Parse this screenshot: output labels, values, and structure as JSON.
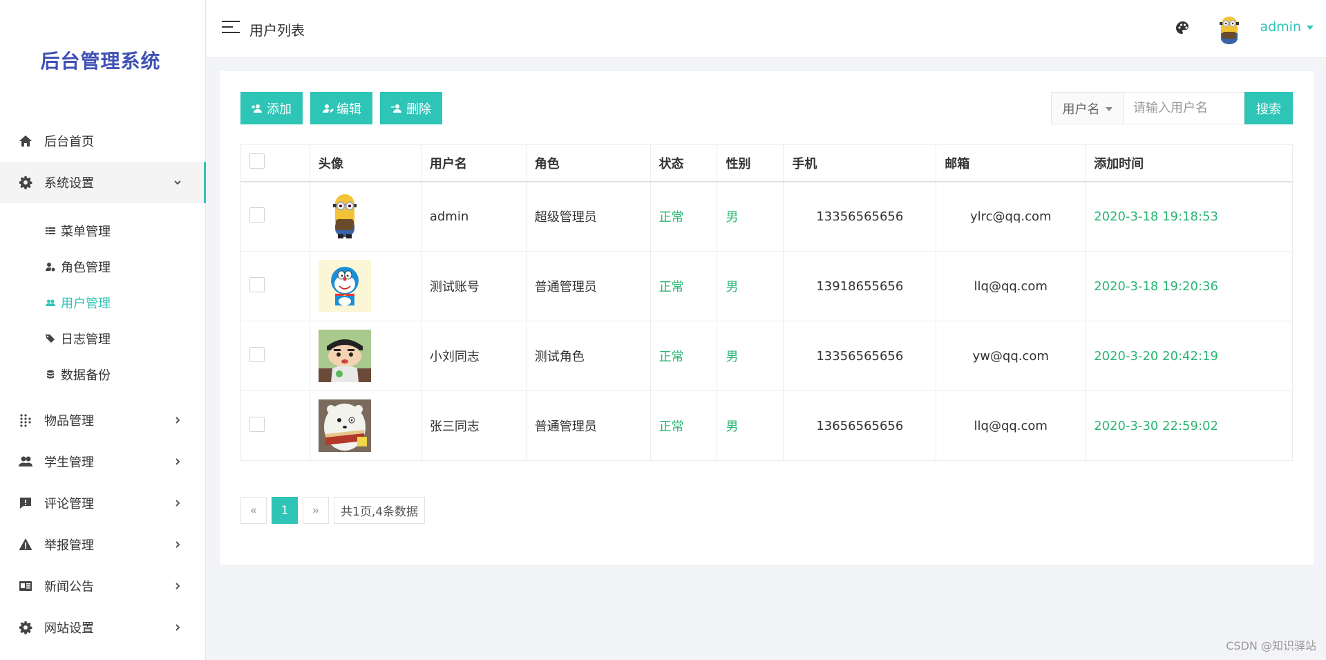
{
  "brand": "后台管理系统",
  "header": {
    "title": "用户列表",
    "username": "admin"
  },
  "sidebar": {
    "home": "后台首页",
    "system": {
      "label": "系统设置",
      "items": [
        {
          "label": "菜单管理",
          "icon": "list-icon"
        },
        {
          "label": "角色管理",
          "icon": "user-gear-icon"
        },
        {
          "label": "用户管理",
          "icon": "users-icon",
          "active": true
        },
        {
          "label": "日志管理",
          "icon": "tags-icon"
        },
        {
          "label": "数据备份",
          "icon": "database-icon"
        }
      ]
    },
    "menus": [
      "物品管理",
      "学生管理",
      "评论管理",
      "举报管理",
      "新闻公告",
      "网站设置"
    ]
  },
  "toolbar": {
    "add": "添加",
    "edit": "编辑",
    "delete": "删除"
  },
  "search": {
    "field": "用户名",
    "placeholder": "请输入用户名",
    "button": "搜索"
  },
  "table": {
    "headers": [
      "头像",
      "用户名",
      "角色",
      "状态",
      "性别",
      "手机",
      "邮箱",
      "添加时间"
    ],
    "rows": [
      {
        "username": "admin",
        "role": "超级管理员",
        "status": "正常",
        "gender": "男",
        "phone": "13356565656",
        "email": "ylrc@qq.com",
        "time": "2020-3-18 19:18:53",
        "avatar": "minion"
      },
      {
        "username": "测试账号",
        "role": "普通管理员",
        "status": "正常",
        "gender": "男",
        "phone": "13918655656",
        "email": "llq@qq.com",
        "time": "2020-3-18 19:20:36",
        "avatar": "doraemon"
      },
      {
        "username": "小刘同志",
        "role": "测试角色",
        "status": "正常",
        "gender": "男",
        "phone": "13356565656",
        "email": "yw@qq.com",
        "time": "2020-3-20 20:42:19",
        "avatar": "shinchan"
      },
      {
        "username": "张三同志",
        "role": "普通管理员",
        "status": "正常",
        "gender": "男",
        "phone": "13656565656",
        "email": "llq@qq.com",
        "time": "2020-3-30 22:59:02",
        "avatar": "polar-bear"
      }
    ]
  },
  "pagination": {
    "prev": "«",
    "current": "1",
    "next": "»",
    "info": "共1页,4条数据"
  },
  "watermark": "CSDN @知识驿站",
  "colors": {
    "accent": "#2ec4b6",
    "brand": "#3f51b5",
    "status_green": "#2ab673"
  }
}
